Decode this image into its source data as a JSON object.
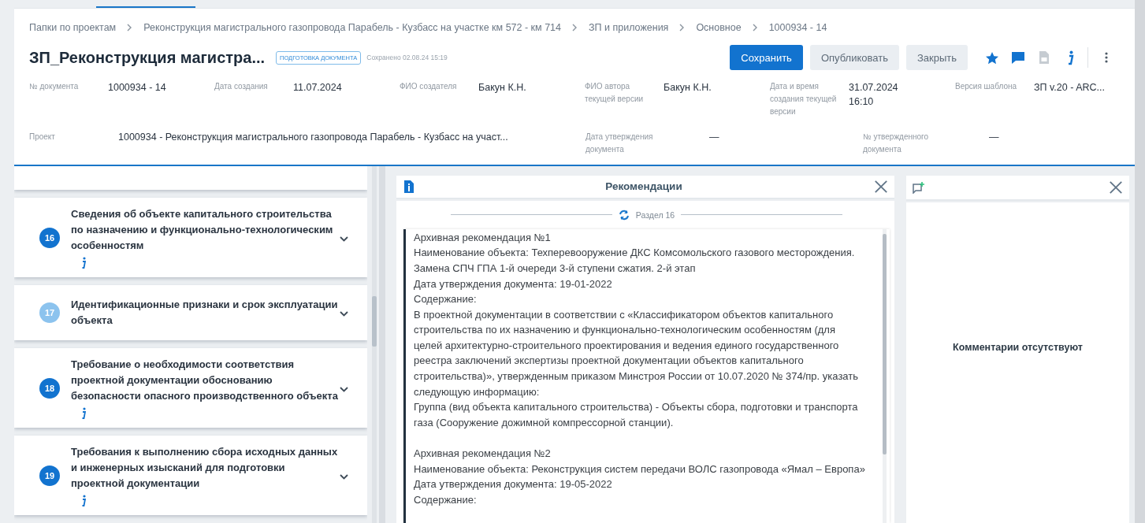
{
  "breadcrumbs": [
    "Папки по проектам",
    "Реконструкция магистрального газопровода Парабель - Кузбасс на участке км 572 - км 714",
    "ЗП и приложения",
    "Основное",
    "1000934 - 14"
  ],
  "document": {
    "title": "ЗП_Реконструкция магистра...",
    "status": "ПОДГОТОВКА ДОКУМЕНТА",
    "saved": "Сохранено 02.08.24 15:19"
  },
  "actions": [
    {
      "label": "Сохранить",
      "kind": "primary"
    },
    {
      "label": "Опубликовать",
      "kind": "secondary"
    },
    {
      "label": "Закрыть",
      "kind": "secondary"
    }
  ],
  "tools": [
    {
      "kind": "star",
      "disabled": false
    },
    {
      "kind": "comment",
      "disabled": false
    },
    {
      "kind": "file",
      "disabled": true
    },
    {
      "kind": "info",
      "disabled": false
    },
    {
      "kind": "more",
      "disabled": false
    }
  ],
  "fields": [
    {
      "label": "№ документа",
      "value": "1000934 - 14"
    },
    {
      "label": "Дата создания",
      "value": "11.07.2024"
    },
    {
      "label": "ФИО создателя",
      "value": "Бакун К.Н."
    },
    {
      "label": "ФИО автора текущей версии",
      "value": "Бакун К.Н."
    },
    {
      "label": "Дата и время создания текущей версии",
      "value": "31.07.2024 16:10"
    },
    {
      "label": "Версия шаблона",
      "value": "ЗП v.20 - ARC..."
    }
  ],
  "fields_row2": [
    {
      "label": "Проект",
      "value": "1000934 - Реконструкция магистрального газопровода Парабель - Кузбасс на участ..."
    },
    {
      "label": "Дата утверждения документа",
      "value": "—"
    },
    {
      "label": "№ утвержденного документа",
      "value": "—"
    }
  ],
  "sections": [
    {
      "number": "16",
      "title": "Сведения об объекте капитального строительства по назначению и функционально-технологическим особенностям",
      "active": true,
      "info": true
    },
    {
      "number": "17",
      "title": "Идентификационные признаки и срок эксплуатации объекта",
      "active": false,
      "info": false
    },
    {
      "number": "18",
      "title": "Требование о необходимости соответствия проектной документации обоснованию безопасности опасного производственного объекта",
      "active": true,
      "info": true
    },
    {
      "number": "19",
      "title": "Требования к выполнению сбора исходных данных и инженерных изысканий для подготовки проектной документации",
      "active": true,
      "info": true
    }
  ],
  "recommendations": {
    "title": "Рекомендации",
    "section": "Раздел 16",
    "records": [
      {
        "paragraphs": [
          "Архивная рекомендация №1",
          "Наименование объекта: Техперевооружение ДКС Комсомольского газового месторождения. Замена СПЧ ГПА 1-й очереди 3-й ступени сжатия. 2-й этап",
          "Дата утверждения документа: 19-01-2022",
          "Содержание:",
          "В проектной документации в соответствии с «Классификатором объектов капитального строительства по их назначению и функционально-технологическим особенностям (для целей архитектурно-строительного проектирования и ведения единого государственного реестра заключений экспертизы проектной документации объектов капитального строительства)», утвержденным приказом Минстроя России от 10.07.2020 № 374/пр. указать следующую информацию:",
          "Группа (вид объекта капитального строительства) - Объекты сбора, подготовки и транспорта газа (Сооружение дожимной компрессорной станции)."
        ]
      },
      {
        "paragraphs": [
          "Архивная рекомендация №2",
          "Наименование объекта: Реконструкция систем передачи ВОЛС газопровода «Ямал – Европа»",
          "Дата утверждения документа: 19-05-2022",
          "Содержание:"
        ]
      }
    ]
  },
  "comments": {
    "empty_text": "Комментарии отсутствуют"
  }
}
